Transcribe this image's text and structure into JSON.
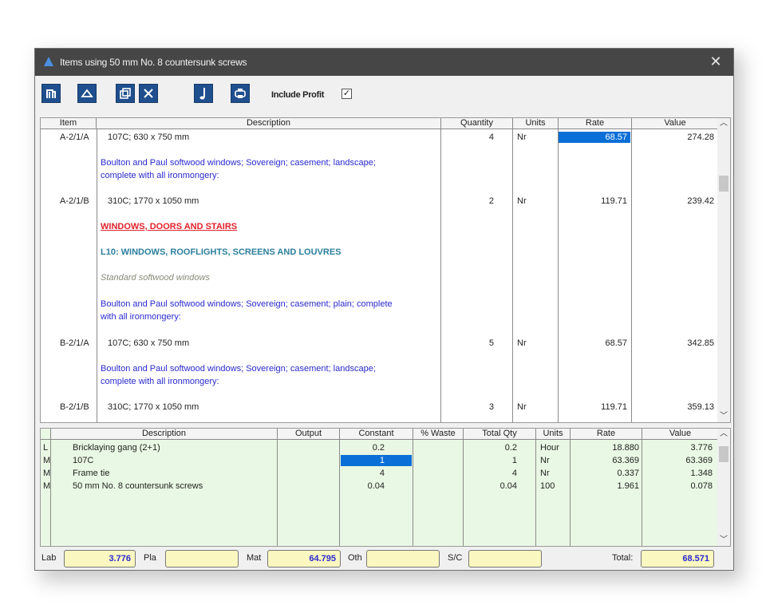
{
  "window": {
    "title": "Items using 50 mm No. 8 countersunk screws"
  },
  "toolbar": {
    "include_profit_label": "Include Profit",
    "include_profit_checked": true,
    "buttons": [
      "column-icon",
      "eraser-icon",
      "copy-icon",
      "scissors-icon",
      "music-note-icon",
      "printer-icon"
    ]
  },
  "items_grid": {
    "columns": [
      "Item",
      "Description",
      "Quantity",
      "Units",
      "Rate",
      "Value"
    ],
    "rows": [
      {
        "item": "A-2/1/A",
        "description": "107C; 630 x 750 mm",
        "quantity": "4",
        "units": "Nr",
        "rate": "68.57",
        "value": "274.28",
        "style": "plain"
      },
      {
        "item": "",
        "description": "Boulton and Paul softwood windows; Sovereign; casement; landscape;",
        "description2": "complete with all ironmongery:",
        "quantity": "",
        "units": "",
        "rate": "",
        "value": "",
        "style": "blue"
      },
      {
        "item": "A-2/1/B",
        "description": "310C; 1770 x 1050 mm",
        "quantity": "2",
        "units": "Nr",
        "rate": "119.71",
        "value": "239.42",
        "style": "plain"
      },
      {
        "item": "",
        "description": "WINDOWS, DOORS AND STAIRS",
        "quantity": "",
        "units": "",
        "rate": "",
        "value": "",
        "style": "red"
      },
      {
        "item": "",
        "description": "L10: WINDOWS, ROOFLIGHTS, SCREENS AND LOUVRES",
        "quantity": "",
        "units": "",
        "rate": "",
        "value": "",
        "style": "teal"
      },
      {
        "item": "",
        "description": "Standard softwood windows",
        "quantity": "",
        "units": "",
        "rate": "",
        "value": "",
        "style": "grey"
      },
      {
        "item": "",
        "description": "Boulton and Paul softwood windows; Sovereign; casement; plain; complete",
        "description2": "with all ironmongery:",
        "quantity": "",
        "units": "",
        "rate": "",
        "value": "",
        "style": "blue"
      },
      {
        "item": "B-2/1/A",
        "description": "107C; 630 x 750 mm",
        "quantity": "5",
        "units": "Nr",
        "rate": "68.57",
        "value": "342.85",
        "style": "plain"
      },
      {
        "item": "",
        "description": "Boulton and Paul softwood windows; Sovereign; casement; landscape;",
        "description2": "complete with all ironmongery:",
        "quantity": "",
        "units": "",
        "rate": "",
        "value": "",
        "style": "blue"
      },
      {
        "item": "B-2/1/B",
        "description": "310C; 1770 x 1050 mm",
        "quantity": "3",
        "units": "Nr",
        "rate": "119.71",
        "value": "359.13",
        "style": "plain"
      }
    ]
  },
  "resources_grid": {
    "columns": [
      "Description",
      "Output",
      "Constant",
      "% Waste",
      "Total Qty",
      "Units",
      "Rate",
      "Value"
    ],
    "rows": [
      {
        "type": "L",
        "description": "Bricklaying gang (2+1)",
        "output": "",
        "constant": "0.2",
        "waste": "",
        "total_qty": "0.2",
        "units": "Hour",
        "rate": "18.880",
        "value": "3.776"
      },
      {
        "type": "M",
        "description": "107C",
        "output": "",
        "constant": "1",
        "waste": "",
        "total_qty": "1",
        "units": "Nr",
        "rate": "63.369",
        "value": "63.369"
      },
      {
        "type": "M",
        "description": "Frame tie",
        "output": "",
        "constant": "4",
        "waste": "",
        "total_qty": "4",
        "units": "Nr",
        "rate": "0.337",
        "value": "1.348"
      },
      {
        "type": "M",
        "description": "50 mm No. 8 countersunk screws",
        "output": "",
        "constant": "0.04",
        "waste": "",
        "total_qty": "0.04",
        "units": "100",
        "rate": "1.961",
        "value": "0.078"
      }
    ]
  },
  "footer": {
    "lab_label": "Lab",
    "lab_value": "3.776",
    "pla_label": "Pla",
    "pla_value": "",
    "mat_label": "Mat",
    "mat_value": "64.795",
    "oth_label": "Oth",
    "oth_value": "",
    "sc_label": "S/C",
    "sc_value": "",
    "total_label": "Total:",
    "total_value": "68.571"
  },
  "colors": {
    "titlebar": "#464646",
    "accent": "#1f4f8e",
    "selection": "#0a6fd6",
    "resource_bg": "#e9f8e4",
    "footer_box": "#fbf7c0"
  }
}
